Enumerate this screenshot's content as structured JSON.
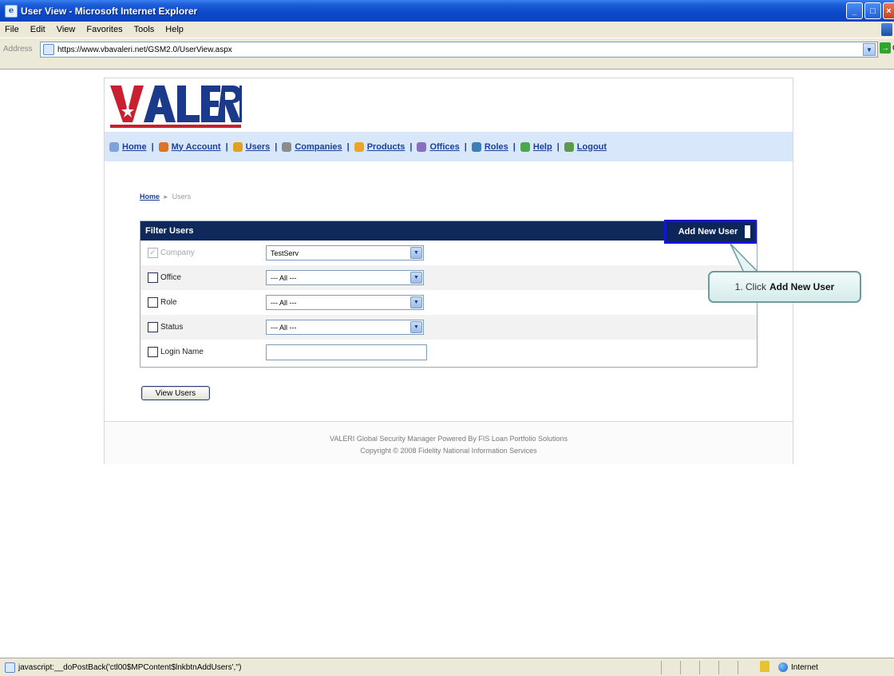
{
  "window": {
    "title": "User View - Microsoft Internet Explorer",
    "app_icon_glyph": "e",
    "buttons": {
      "minimize": "_",
      "maximize": "□",
      "close": "×"
    }
  },
  "menubar": {
    "items": [
      "File",
      "Edit",
      "View",
      "Favorites",
      "Tools",
      "Help"
    ]
  },
  "address": {
    "label": "Address",
    "url": "https://www.vbavaleri.net/GSM2.0/UserView.aspx",
    "dropdown_glyph": "▼",
    "go_glyph": "→",
    "go_label": "Go"
  },
  "logo": {
    "text": "VALERI",
    "colors": {
      "blue": "#1b3a8c",
      "red": "#c8202f"
    }
  },
  "nav": {
    "items": [
      {
        "label": "Home",
        "icon": "home-icon",
        "color": "#7fa3d9"
      },
      {
        "label": "My Account",
        "icon": "account-icon",
        "color": "#d9742b"
      },
      {
        "label": "Users",
        "icon": "users-icon",
        "color": "#e0a020"
      },
      {
        "label": "Companies",
        "icon": "companies-icon",
        "color": "#8c8c8c"
      },
      {
        "label": "Products",
        "icon": "products-icon",
        "color": "#e8a72b"
      },
      {
        "label": "Offices",
        "icon": "offices-icon",
        "color": "#8a6fbf"
      },
      {
        "label": "Roles",
        "icon": "roles-icon",
        "color": "#3a7fb8"
      },
      {
        "label": "Help",
        "icon": "help-icon",
        "color": "#4aa84a"
      },
      {
        "label": "Logout",
        "icon": "logout-icon",
        "color": "#5a9a4a"
      }
    ],
    "separator": "|"
  },
  "breadcrumb": {
    "home": "Home",
    "arrow": "▸",
    "current": "Users"
  },
  "filter": {
    "title": "Filter Users",
    "add_button": "Add New User",
    "rows": [
      {
        "label": "Company",
        "checked": true,
        "disabled": true,
        "value": "TestServ",
        "check_glyph": "✓"
      },
      {
        "label": "Office",
        "checked": false,
        "value": "--- All ---"
      },
      {
        "label": "Role",
        "checked": false,
        "value": "--- All ---"
      },
      {
        "label": "Status",
        "checked": false,
        "value": "--- All ---"
      },
      {
        "label": "Login Name",
        "checked": false,
        "value": ""
      }
    ],
    "dropdown_glyph": "▼"
  },
  "view_button": "View Users",
  "footer": {
    "line1": "VALERI Global Security Manager Powered By FIS Loan Portfolio Solutions",
    "line2": "Copyright © 2008 Fidelity National Information Services"
  },
  "callout": {
    "prefix": "1. Click",
    "bold": "Add New User"
  },
  "statusbar": {
    "text": "javascript:__doPostBack('ctl00$MPContent$lnkbtnAddUsers','')",
    "zone": "Internet"
  }
}
